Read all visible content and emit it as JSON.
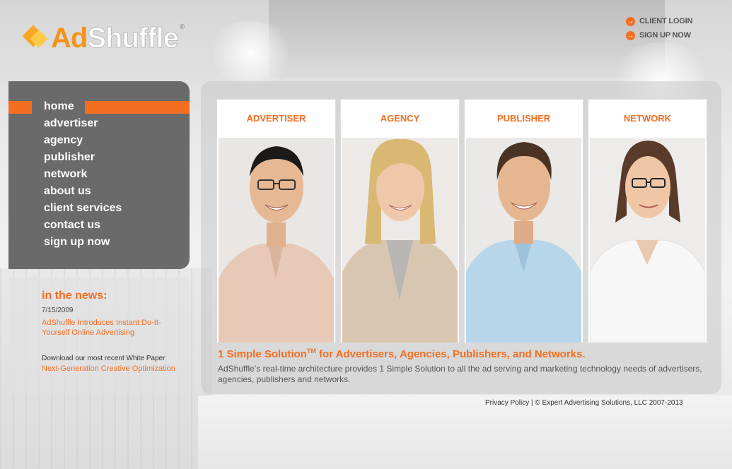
{
  "logo": {
    "ad": "Ad",
    "shuffle": "Shuffle",
    "reg": "®"
  },
  "top_links": {
    "client_login": "CLIENT LOGIN",
    "sign_up_now": "SIGN UP NOW"
  },
  "nav": {
    "items": [
      {
        "label": "home",
        "active": true
      },
      {
        "label": "advertiser"
      },
      {
        "label": "agency"
      },
      {
        "label": "publisher"
      },
      {
        "label": "network"
      },
      {
        "label": "about us"
      },
      {
        "label": "client services"
      },
      {
        "label": "contact us"
      },
      {
        "label": "sign up now"
      }
    ]
  },
  "news": {
    "title": "in the news:",
    "date": "7/15/2009",
    "headline": "AdShuffle Introduces Instant Do-It-Yourself Online Advertising",
    "whitepaper_text": "Download our most recent White Paper",
    "whitepaper_link": "Next-Generation Creative Optimization"
  },
  "cards": [
    {
      "label": "ADVERTISER"
    },
    {
      "label": "AGENCY"
    },
    {
      "label": "PUBLISHER"
    },
    {
      "label": "NETWORK"
    }
  ],
  "tagline": {
    "pre": "1 Simple Solution",
    "tm": "TM",
    "post": " for Advertisers, Agencies, Publishers, and Networks."
  },
  "description": "AdShuffle’s real-time architecture provides 1 Simple Solution to all the ad serving and marketing technology needs of advertisers, agencies, publishers and networks.",
  "footer": {
    "privacy": "Privacy Policy",
    "copyright": " | © Expert Advertising Solutions, LLC 2007-2013"
  },
  "colors": {
    "accent": "#f36e21",
    "nav_bg": "#6a6a6a"
  }
}
